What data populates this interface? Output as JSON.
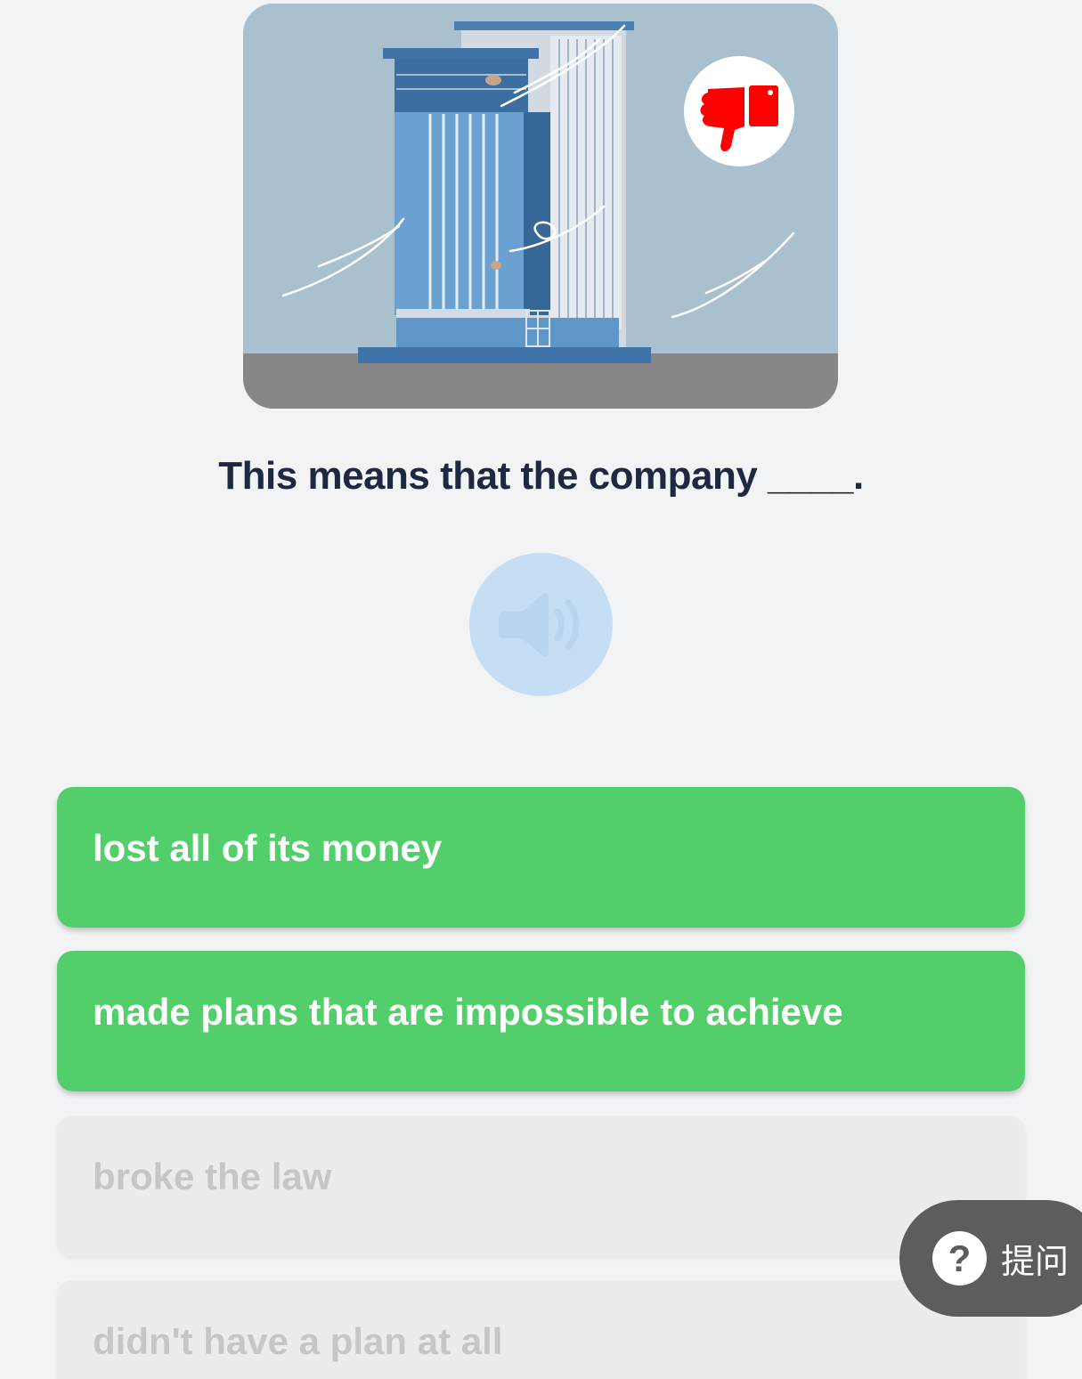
{
  "question": {
    "text": "This means that the company ____."
  },
  "audio": {
    "icon": "speaker-icon"
  },
  "illustration": {
    "icon": "thumbs-down-icon"
  },
  "options": [
    {
      "label": "lost all of its money",
      "state": "selected"
    },
    {
      "label": "made plans that are impossible to achieve",
      "state": "selected"
    },
    {
      "label": "broke the law",
      "state": "disabled"
    },
    {
      "label": "didn't have a plan at all",
      "state": "disabled"
    }
  ],
  "ask_button": {
    "icon": "question-icon",
    "icon_glyph": "?",
    "label": "提问"
  },
  "colors": {
    "selected_option": "#52cf6b",
    "disabled_option": "#ebecee",
    "question_text": "#1e2840",
    "audio_button": "#c5def4",
    "ask_button": "#5b5d5e",
    "thumbs_down": "#ff0000"
  }
}
